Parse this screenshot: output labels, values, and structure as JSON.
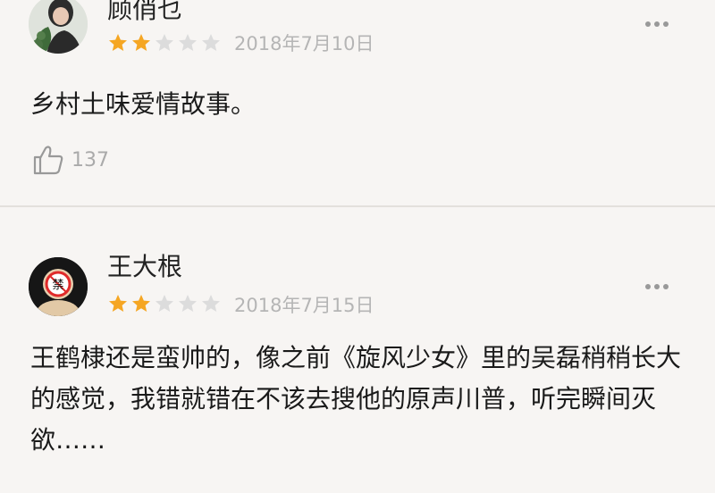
{
  "reviews": [
    {
      "user_name": "顾俏乜",
      "rating": 2,
      "max_rating": 5,
      "date": "2018年7月10日",
      "content": "乡村土味爱情故事。",
      "likes": "137",
      "icons": {
        "more": "more-horizontal-icon",
        "like": "thumbs-up-icon"
      }
    },
    {
      "user_name": "王大根",
      "rating": 2,
      "max_rating": 5,
      "date": "2018年7月15日",
      "content": "王鹤棣还是蛮帅的，像之前《旋风少女》里的吴磊稍稍长大的感觉，我错就错在不该去搜他的原声川普，听完瞬间灭欲……",
      "avatar_badge": "禁",
      "icons": {
        "more": "more-horizontal-icon"
      }
    }
  ],
  "colors": {
    "star_filled": "#f5a623",
    "star_empty": "#dcdcdc",
    "date": "#b5b5b5"
  }
}
